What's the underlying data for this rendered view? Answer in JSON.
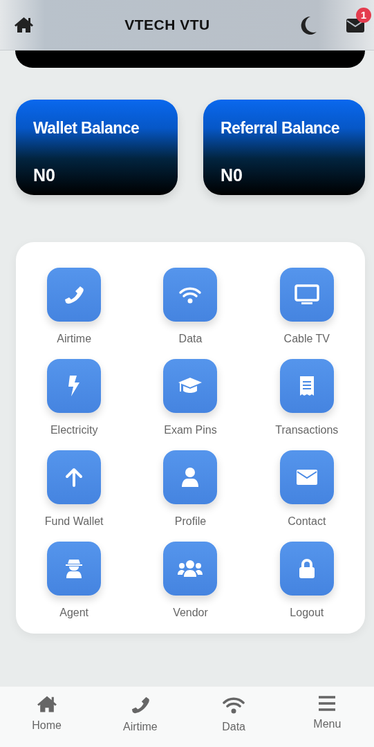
{
  "header": {
    "title": "VTECH VTU",
    "notification_count": "1"
  },
  "balances": [
    {
      "label": "Wallet Balance",
      "amount": "N0"
    },
    {
      "label": "Referral Balance",
      "amount": "N0"
    }
  ],
  "services": [
    {
      "label": "Airtime"
    },
    {
      "label": "Data"
    },
    {
      "label": "Cable TV"
    },
    {
      "label": "Electricity"
    },
    {
      "label": "Exam Pins"
    },
    {
      "label": "Transactions"
    },
    {
      "label": "Fund Wallet"
    },
    {
      "label": "Profile"
    },
    {
      "label": "Contact"
    },
    {
      "label": "Agent"
    },
    {
      "label": "Vendor"
    },
    {
      "label": "Logout"
    }
  ],
  "bottom_nav": [
    {
      "label": "Home"
    },
    {
      "label": "Airtime"
    },
    {
      "label": "Data"
    },
    {
      "label": "Menu"
    }
  ]
}
